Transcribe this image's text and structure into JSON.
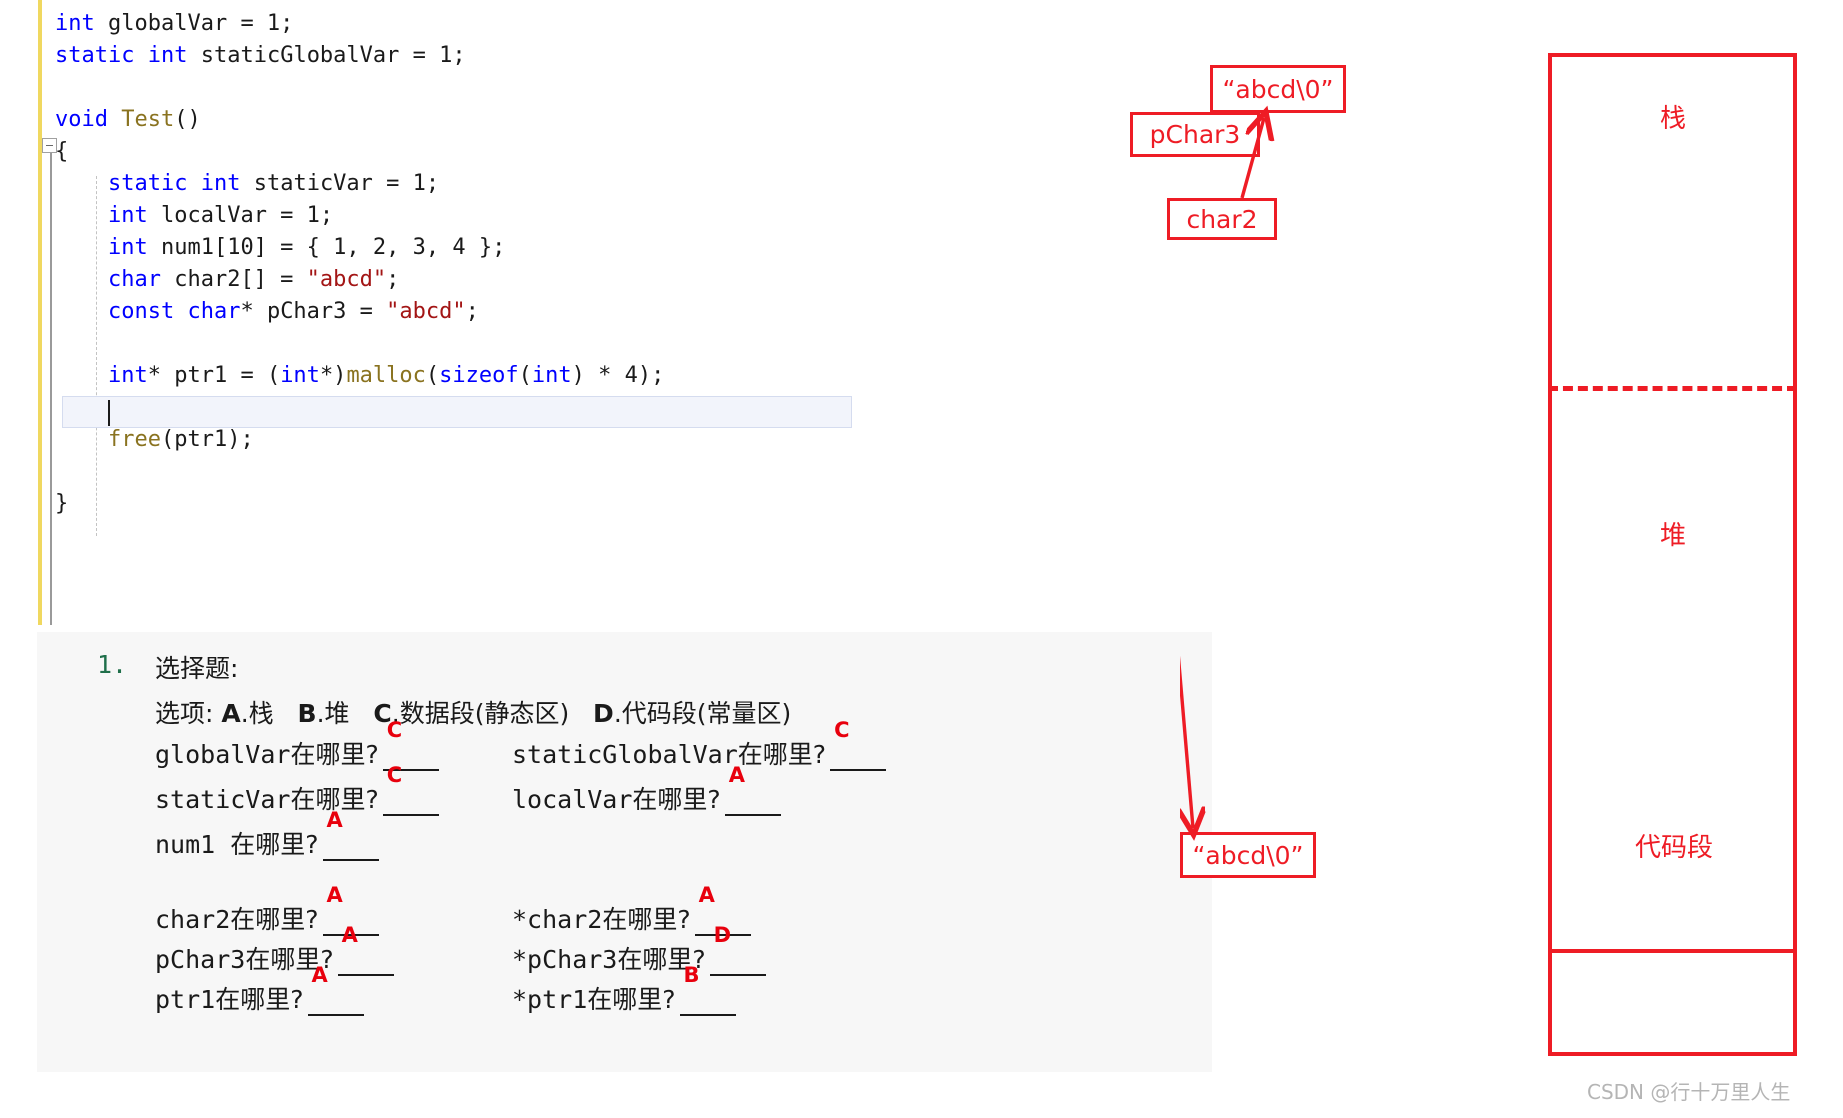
{
  "editor": {
    "code_lines": [
      [
        {
          "t": "int",
          "c": "kw"
        },
        {
          "t": " globalVar = 1;",
          "c": "pl"
        }
      ],
      [
        {
          "t": "static",
          "c": "kw"
        },
        {
          "t": " ",
          "c": "pl"
        },
        {
          "t": "int",
          "c": "kw"
        },
        {
          "t": " staticGlobalVar = 1;",
          "c": "pl"
        }
      ],
      [],
      [
        {
          "t": "void",
          "c": "kw"
        },
        {
          "t": " ",
          "c": "pl"
        },
        {
          "t": "Test",
          "c": "fn"
        },
        {
          "t": "()",
          "c": "pl"
        }
      ],
      [
        {
          "t": "{",
          "c": "pl"
        }
      ],
      [
        {
          "t": "    ",
          "c": "pl"
        },
        {
          "t": "static",
          "c": "kw"
        },
        {
          "t": " ",
          "c": "pl"
        },
        {
          "t": "int",
          "c": "kw"
        },
        {
          "t": " staticVar = 1;",
          "c": "pl"
        }
      ],
      [
        {
          "t": "    ",
          "c": "pl"
        },
        {
          "t": "int",
          "c": "kw"
        },
        {
          "t": " localVar = 1;",
          "c": "pl"
        }
      ],
      [
        {
          "t": "    ",
          "c": "pl"
        },
        {
          "t": "int",
          "c": "kw"
        },
        {
          "t": " num1[10] = { 1, 2, 3, 4 };",
          "c": "pl"
        }
      ],
      [
        {
          "t": "    ",
          "c": "pl"
        },
        {
          "t": "char",
          "c": "kw"
        },
        {
          "t": " char2[] = ",
          "c": "pl"
        },
        {
          "t": "\"abcd\"",
          "c": "str"
        },
        {
          "t": ";",
          "c": "pl"
        }
      ],
      [
        {
          "t": "    ",
          "c": "pl"
        },
        {
          "t": "const",
          "c": "kw"
        },
        {
          "t": " ",
          "c": "pl"
        },
        {
          "t": "char",
          "c": "kw"
        },
        {
          "t": "* pChar3 = ",
          "c": "pl"
        },
        {
          "t": "\"abcd\"",
          "c": "str"
        },
        {
          "t": ";",
          "c": "pl"
        }
      ],
      [],
      [
        {
          "t": "    ",
          "c": "pl"
        },
        {
          "t": "int",
          "c": "kw"
        },
        {
          "t": "* ptr1 = (",
          "c": "pl"
        },
        {
          "t": "int",
          "c": "kw"
        },
        {
          "t": "*)",
          "c": "pl"
        },
        {
          "t": "malloc",
          "c": "fn"
        },
        {
          "t": "(",
          "c": "pl"
        },
        {
          "t": "sizeof",
          "c": "kw"
        },
        {
          "t": "(",
          "c": "pl"
        },
        {
          "t": "int",
          "c": "kw"
        },
        {
          "t": ") * 4);",
          "c": "pl"
        }
      ],
      [],
      [
        {
          "t": "    ",
          "c": "pl"
        },
        {
          "t": "free",
          "c": "fn"
        },
        {
          "t": "(ptr1);",
          "c": "pl"
        }
      ],
      [],
      [
        {
          "t": "}",
          "c": "pl"
        }
      ]
    ]
  },
  "quiz": {
    "number": "1.",
    "title": "选择题:",
    "options_prefix": "选项:",
    "options": [
      {
        "letter": "A",
        "text": ".栈"
      },
      {
        "letter": "B",
        "text": ".堆"
      },
      {
        "letter": "C",
        "text": ".数据段(静态区)"
      },
      {
        "letter": "D",
        "text": ".代码段(常量区)"
      }
    ],
    "rows": [
      {
        "left_var": "globalVar",
        "left_q": "在哪里?",
        "left_answer": "C",
        "right_var": "staticGlobalVar",
        "right_q": "在哪里?",
        "right_answer": "C"
      },
      {
        "left_var": "staticVar",
        "left_q": "在哪里?",
        "left_answer": "C",
        "right_var": "localVar",
        "right_q": "在哪里?",
        "right_answer": "A"
      },
      {
        "left_var": "num1 ",
        "left_q": "在哪里?",
        "left_answer": "A",
        "right_var": "",
        "right_q": "",
        "right_answer": ""
      },
      {
        "left_var": "char2",
        "left_q": "在哪里?",
        "left_answer": "A",
        "right_var": "*char2",
        "right_q": "在哪里?",
        "right_answer": "A"
      },
      {
        "left_var": "pChar3",
        "left_q": "在哪里?",
        "left_answer": "A",
        "right_var": "*pChar3",
        "right_q": "在哪里?",
        "right_answer": "D"
      },
      {
        "left_var": "ptr1",
        "left_q": "在哪里?",
        "left_answer": "A",
        "right_var": "*ptr1",
        "right_q": "在哪里?",
        "right_answer": "B"
      }
    ]
  },
  "diagram": {
    "accent_color": "#ee1c25",
    "memory_regions": [
      {
        "label": "栈"
      },
      {
        "label": "堆"
      },
      {
        "label": "代码段"
      }
    ],
    "annotations": [
      {
        "label": "“abcd\\0”"
      },
      {
        "label": "pChar3"
      },
      {
        "label": "char2"
      },
      {
        "label": "“abcd\\0”"
      }
    ],
    "watermark": "CSDN @行十万里人生"
  }
}
